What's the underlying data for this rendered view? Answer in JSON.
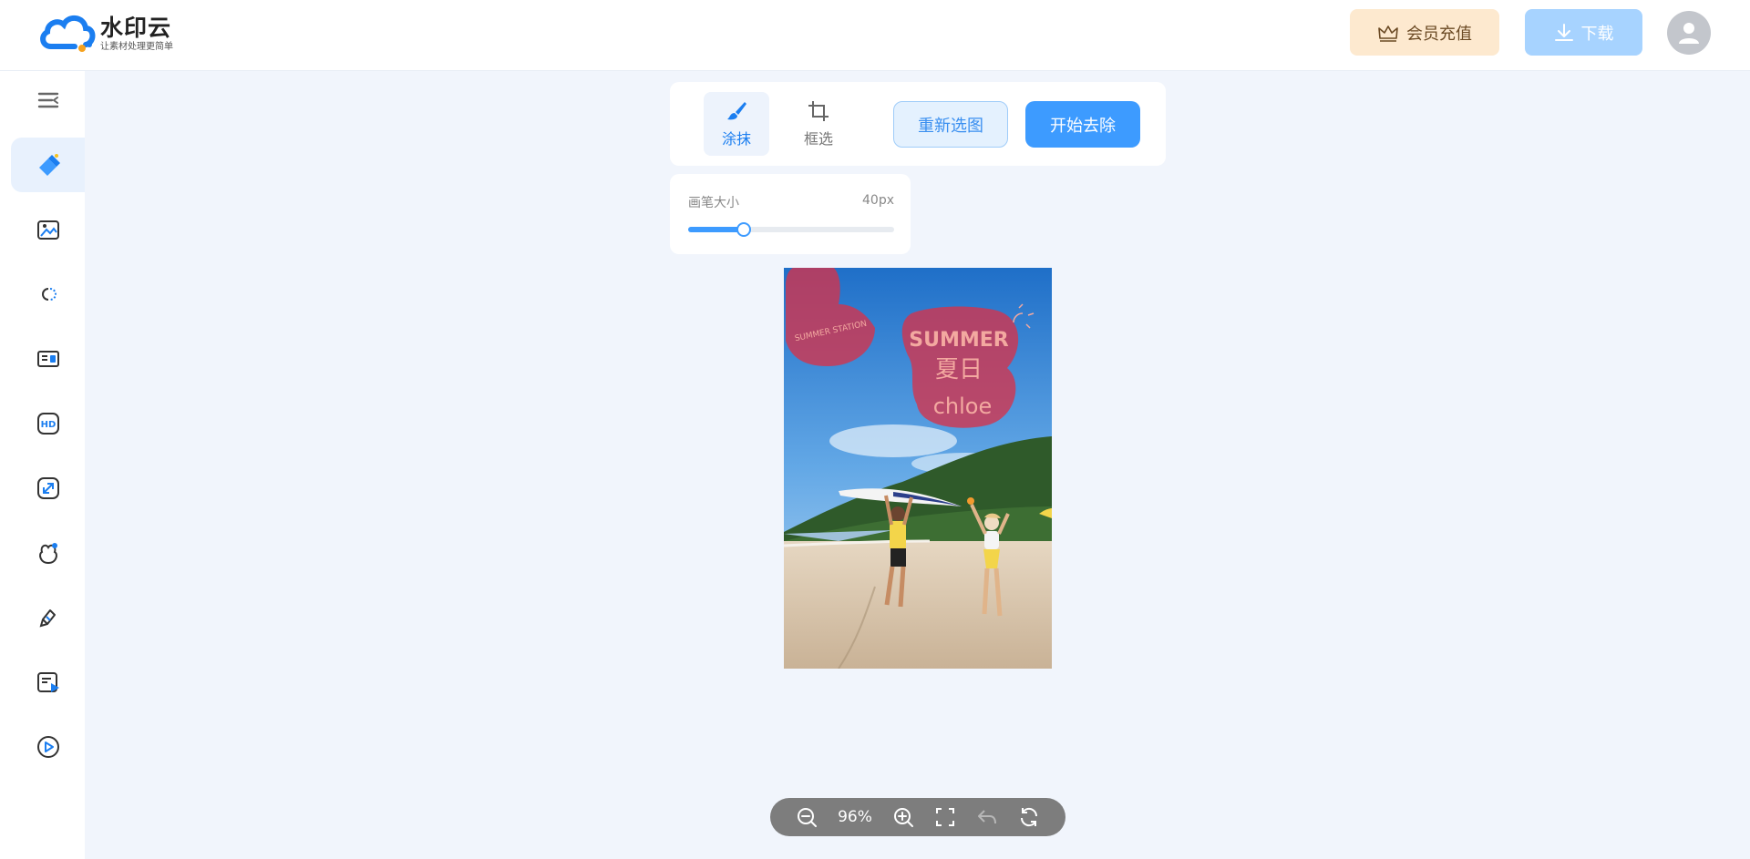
{
  "header": {
    "logo_title": "水印云",
    "logo_subtitle": "让素材处理更简单",
    "vip_label": "会员充值",
    "download_label": "下载",
    "colors": {
      "vip_bg": "#fde9cf",
      "download_bg": "#a7d3ff",
      "accent": "#3d9bff"
    }
  },
  "sidebar": {
    "items": [
      {
        "icon": "collapse-menu-icon"
      },
      {
        "icon": "eraser-icon",
        "active": true
      },
      {
        "icon": "image-edit-icon"
      },
      {
        "icon": "cutout-icon"
      },
      {
        "icon": "id-photo-icon"
      },
      {
        "icon": "hd-icon"
      },
      {
        "icon": "enlarge-icon"
      },
      {
        "icon": "cartoon-icon"
      },
      {
        "icon": "repair-icon"
      },
      {
        "icon": "video-text-icon"
      },
      {
        "icon": "video-play-icon"
      }
    ]
  },
  "toolbar": {
    "paint_label": "涂抹",
    "box_label": "框选",
    "reselect_label": "重新选图",
    "start_label": "开始去除"
  },
  "brush": {
    "label": "画笔大小",
    "value_text": "40px",
    "slider_fraction": 0.27
  },
  "canvas": {
    "poster_text": [
      "SUMMER",
      "夏日",
      "chloe",
      "SUMMER STATION"
    ]
  },
  "zoom": {
    "level": "96%"
  }
}
